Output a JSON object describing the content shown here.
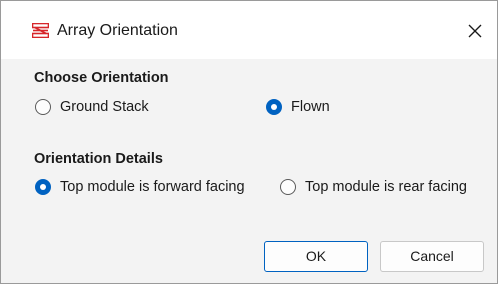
{
  "window": {
    "title": "Array Orientation",
    "icon": "array-app-icon",
    "close_icon": "close-icon",
    "brand_color": "#d7262b",
    "accent_color": "#0062c1"
  },
  "orientation": {
    "heading": "Choose Orientation",
    "options": [
      {
        "label": "Ground Stack",
        "selected": false
      },
      {
        "label": "Flown",
        "selected": true
      }
    ]
  },
  "details": {
    "heading": "Orientation Details",
    "options": [
      {
        "label": "Top module is forward facing",
        "selected": true
      },
      {
        "label": "Top module is rear facing",
        "selected": false
      }
    ]
  },
  "buttons": {
    "ok_label": "OK",
    "cancel_label": "Cancel"
  }
}
